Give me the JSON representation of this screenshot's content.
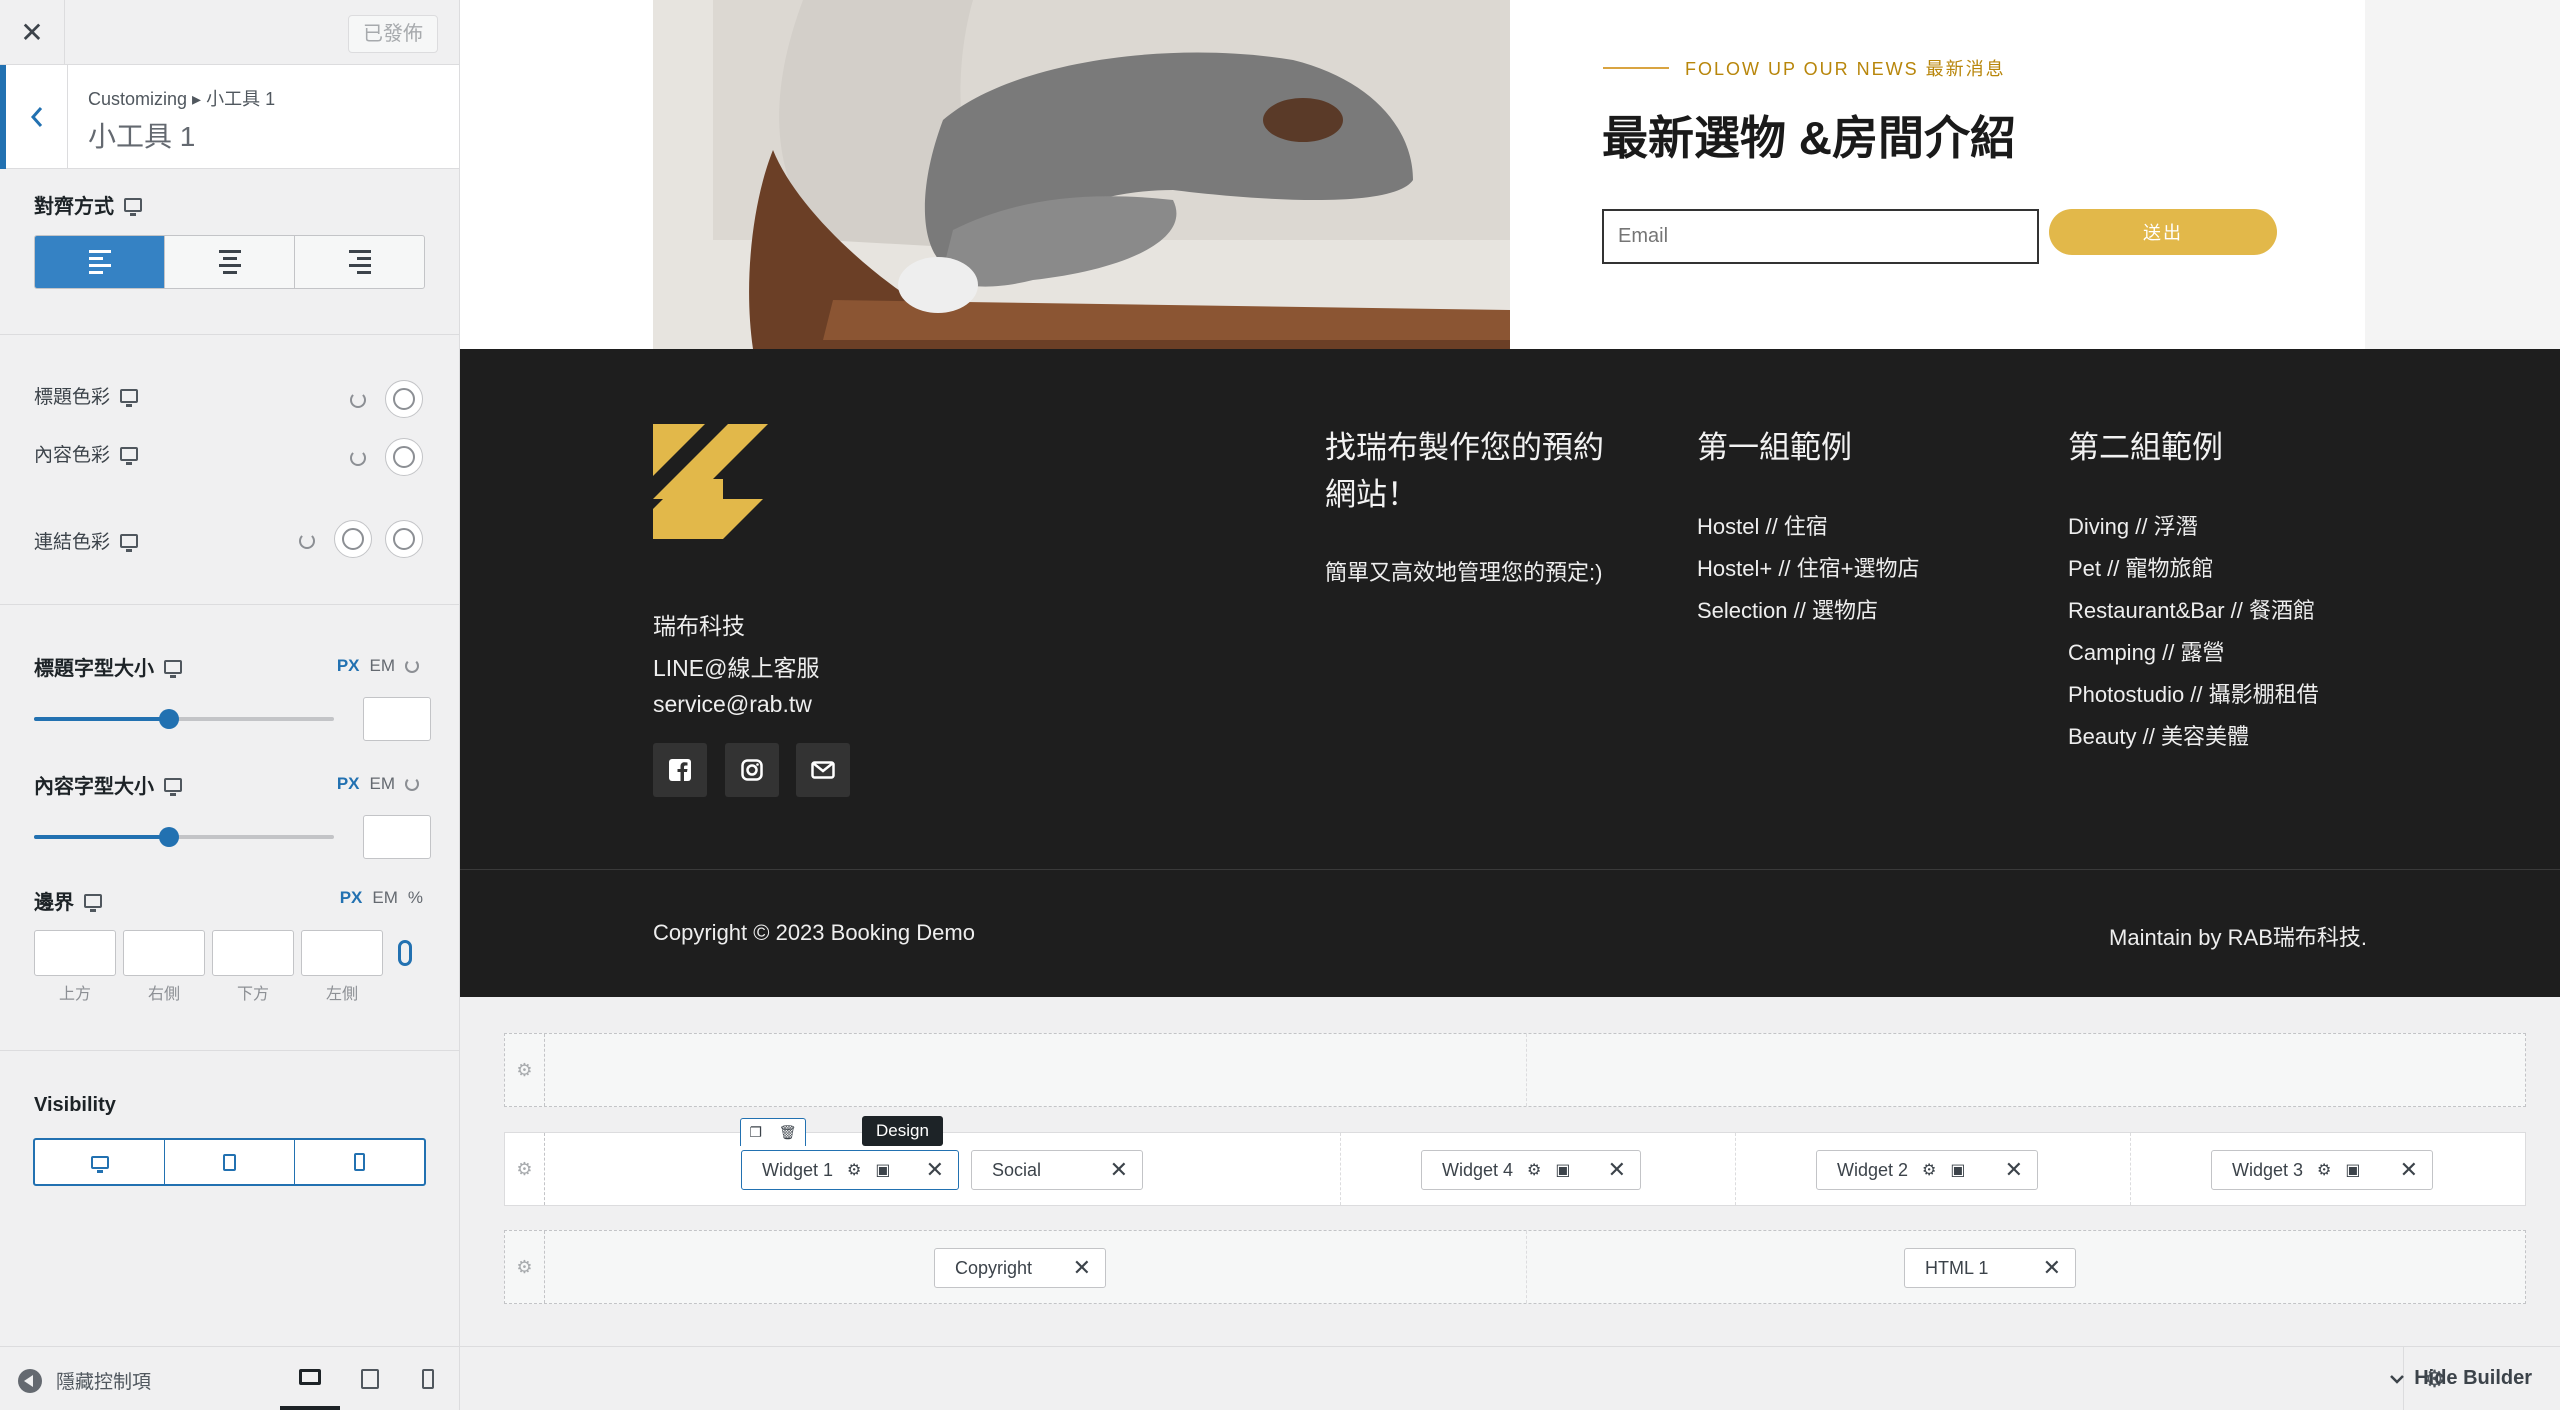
{
  "sidebar": {
    "published_label": "已發佈",
    "breadcrumb": "Customizing ▸ 小工具 1",
    "section_title": "小工具 1",
    "alignment_label": "對齊方式",
    "title_color_label": "標題色彩",
    "content_color_label": "內容色彩",
    "link_color_label": "連結色彩",
    "title_font_size_label": "標題字型大小",
    "content_font_size_label": "內容字型大小",
    "margin_label": "邊界",
    "unit_px": "PX",
    "unit_em": "EM",
    "unit_pct": "%",
    "margin_top": "上方",
    "margin_right": "右側",
    "margin_bottom": "下方",
    "margin_left": "左側",
    "visibility_label": "Visibility",
    "hide_controls_label": "隱藏控制項",
    "title_font_slider_level": 0.45,
    "content_font_slider_level": 0.45
  },
  "preview": {
    "news_eyebrow": "FOLOW UP OUR NEWS 最新消息",
    "news_title": "最新選物 &房間介紹",
    "email_placeholder": "Email",
    "send_label": "送出",
    "footer": {
      "company": "瑞布科技",
      "line": "LINE@線上客服",
      "email": "service@rab.tw",
      "col1_title_line1": "找瑞布製作您的預約",
      "col1_title_line2": "網站！",
      "col1_text": "簡單又高效地管理您的預定:)",
      "col2_title": "第一組範例",
      "col2_links": [
        "Hostel // 住宿",
        "Hostel+ // 住宿+選物店",
        "Selection // 選物店"
      ],
      "col3_title": "第二組範例",
      "col3_links": [
        "Diving // 浮潛",
        "Pet // 寵物旅館",
        "Restaurant&Bar // 餐酒館",
        "Camping // 露營",
        "Photostudio // 攝影棚租借",
        "Beauty // 美容美體"
      ],
      "copyright": "Copyright © 2023 Booking Demo",
      "maintain": "Maintain by RAB瑞布科技."
    },
    "colors": {
      "accent": "#e2b84a",
      "footer_bg": "#1e1e1e",
      "wp_blue": "#2271b1"
    }
  },
  "builder": {
    "tooltip": "Design",
    "chips": {
      "widget1": "Widget 1",
      "social": "Social",
      "widget4": "Widget 4",
      "widget2": "Widget 2",
      "widget3": "Widget 3",
      "copyright": "Copyright",
      "html1": "HTML 1"
    },
    "hide_builder_label": "Hide Builder"
  }
}
